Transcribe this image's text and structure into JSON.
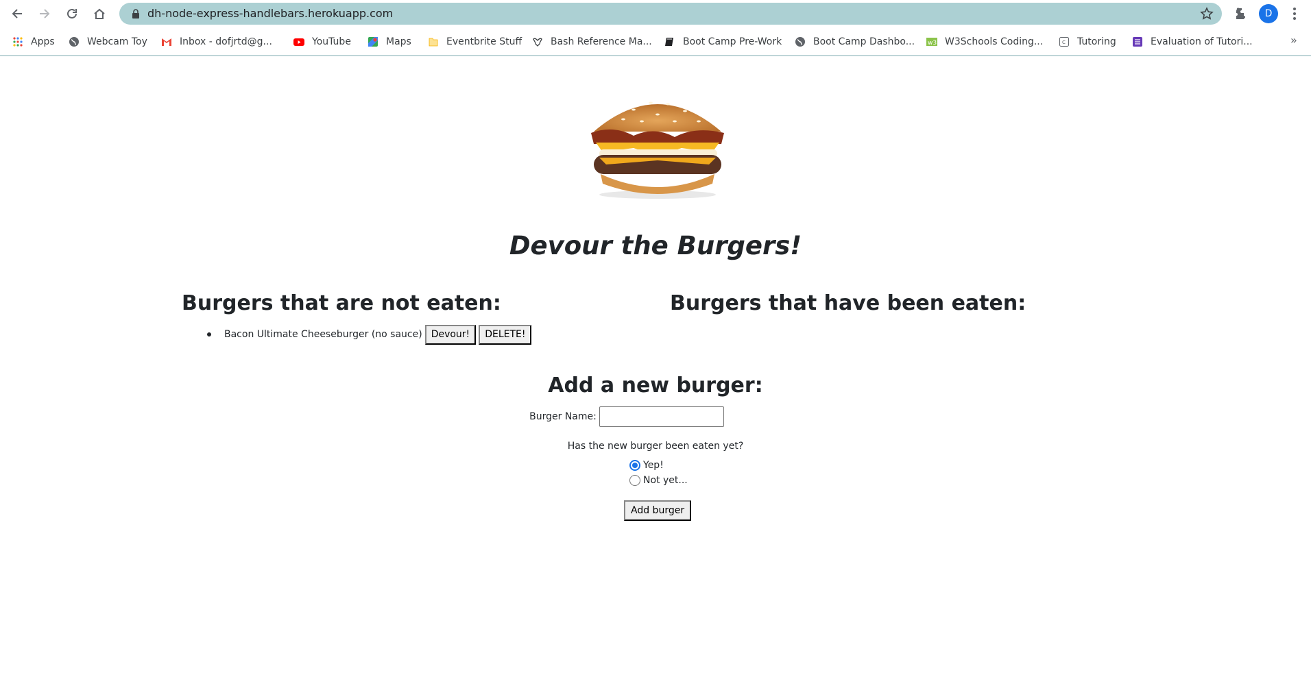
{
  "browser": {
    "url": "dh-node-express-handlebars.herokuapp.com",
    "profile_initial": "D",
    "bookmarks": [
      {
        "label": "Apps",
        "icon": "apps-grid-icon"
      },
      {
        "label": "Webcam Toy",
        "icon": "globe-icon"
      },
      {
        "label": "Inbox - dofjrtd@g...",
        "icon": "gmail-icon"
      },
      {
        "label": "YouTube",
        "icon": "youtube-icon"
      },
      {
        "label": "Maps",
        "icon": "maps-icon"
      },
      {
        "label": "Eventbrite Stuff",
        "icon": "folder-icon"
      },
      {
        "label": "Bash Reference Ma...",
        "icon": "gnu-icon"
      },
      {
        "label": "Boot Camp Pre-Work",
        "icon": "book-icon"
      },
      {
        "label": "Boot Camp Dashbo...",
        "icon": "globe-icon"
      },
      {
        "label": "W3Schools Coding...",
        "icon": "w3schools-icon"
      },
      {
        "label": "Tutoring",
        "icon": "page-icon"
      },
      {
        "label": "Evaluation of Tutori...",
        "icon": "forms-icon"
      }
    ],
    "bookmarks_more": "»"
  },
  "page": {
    "title": "Devour the Burgers!",
    "not_eaten_heading": "Burgers that are not eaten:",
    "eaten_heading": "Burgers that have been eaten:",
    "not_eaten": [
      {
        "name": "Bacon Ultimate Cheeseburger (no sauce)",
        "devour_label": "Devour!",
        "delete_label": "DELETE!"
      }
    ],
    "eaten": [],
    "form": {
      "heading": "Add a new burger:",
      "name_label": "Burger Name:",
      "name_value": "",
      "question": "Has the new burger been eaten yet?",
      "options": [
        {
          "label": "Yep!",
          "checked": true
        },
        {
          "label": "Not yet...",
          "checked": false
        }
      ],
      "submit_label": "Add burger"
    }
  }
}
